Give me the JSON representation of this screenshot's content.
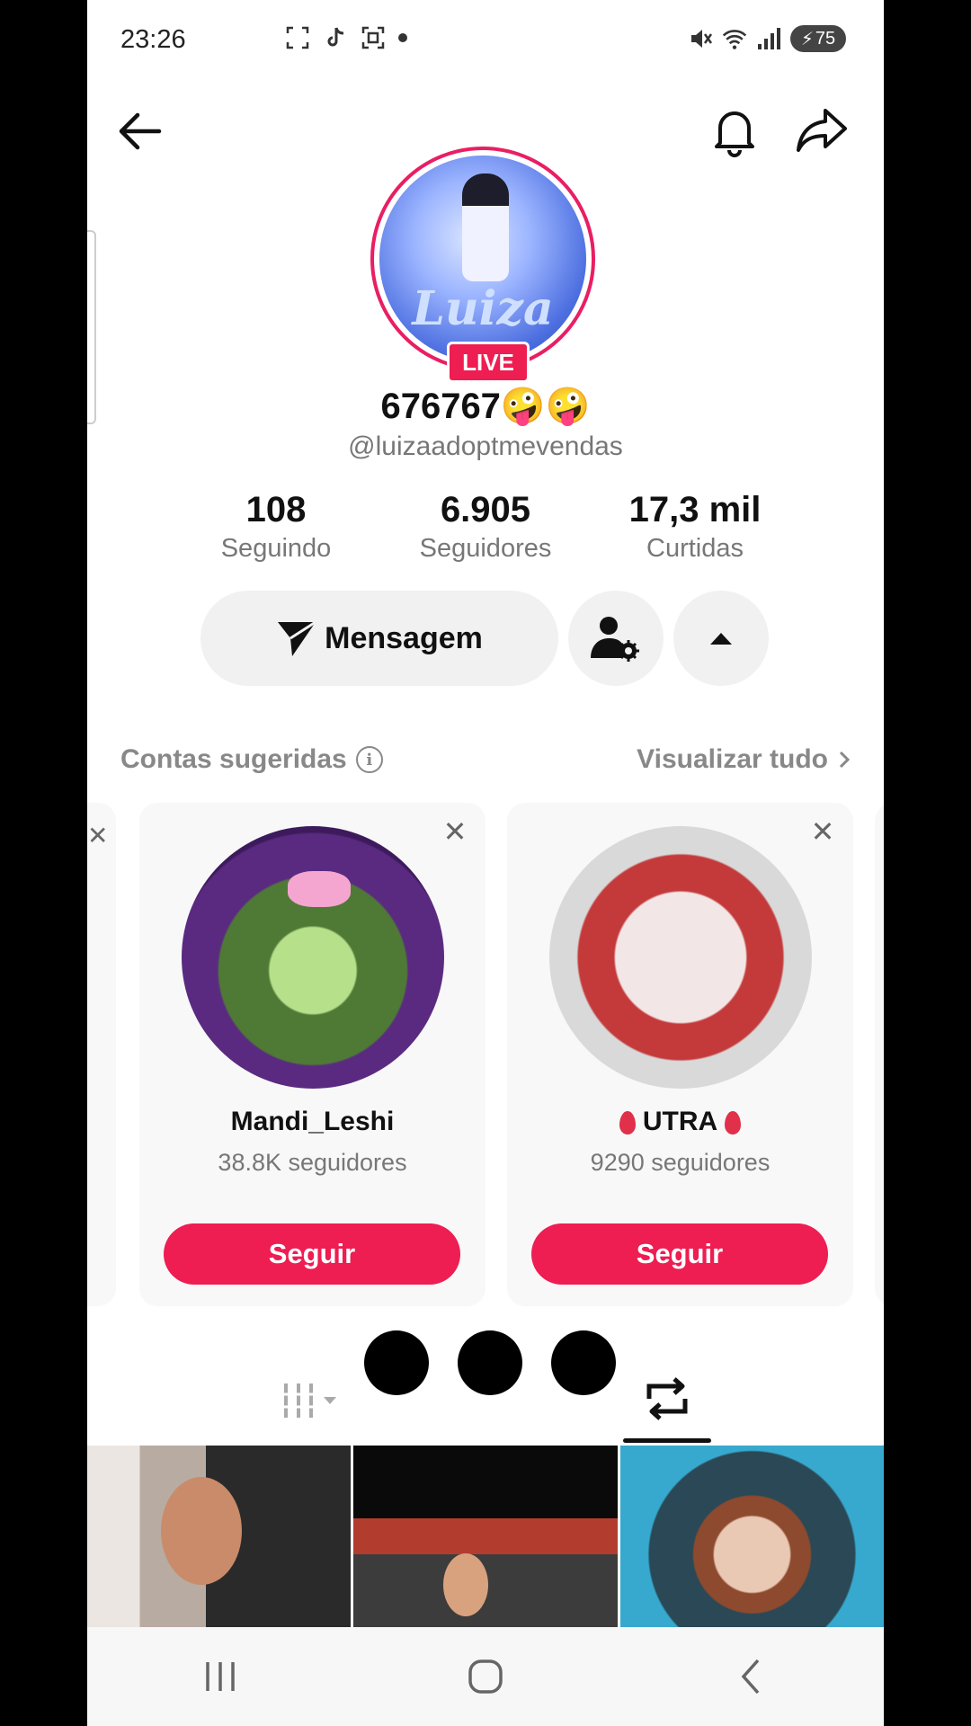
{
  "status_bar": {
    "time": "23:26",
    "battery": "75",
    "icons": [
      "screenshot-icon",
      "tiktok-icon",
      "scan-icon",
      "mute-icon",
      "wifi-icon",
      "signal-icon"
    ]
  },
  "profile": {
    "display_name": "676767🤪🤪",
    "handle": "@luizaadoptmevendas",
    "avatar_text": "Luiza",
    "live_badge": "LIVE",
    "stats": [
      {
        "value": "108",
        "label": "Seguindo"
      },
      {
        "value": "6.905",
        "label": "Seguidores"
      },
      {
        "value": "17,3 mil",
        "label": "Curtidas"
      }
    ]
  },
  "actions": {
    "message_label": "Mensagem"
  },
  "suggested": {
    "title": "Contas sugeridas",
    "view_all": "Visualizar tudo",
    "cards": [
      {
        "name": "Mandi_Leshi",
        "followers": "38.8K seguidores",
        "follow_label": "Seguir"
      },
      {
        "name": "UTRA",
        "followers": "9290 seguidores",
        "follow_label": "Seguir"
      }
    ]
  },
  "colors": {
    "accent": "#ee1d52",
    "text": "#111111",
    "muted": "#777777",
    "button_bg": "#f1f1f2"
  }
}
